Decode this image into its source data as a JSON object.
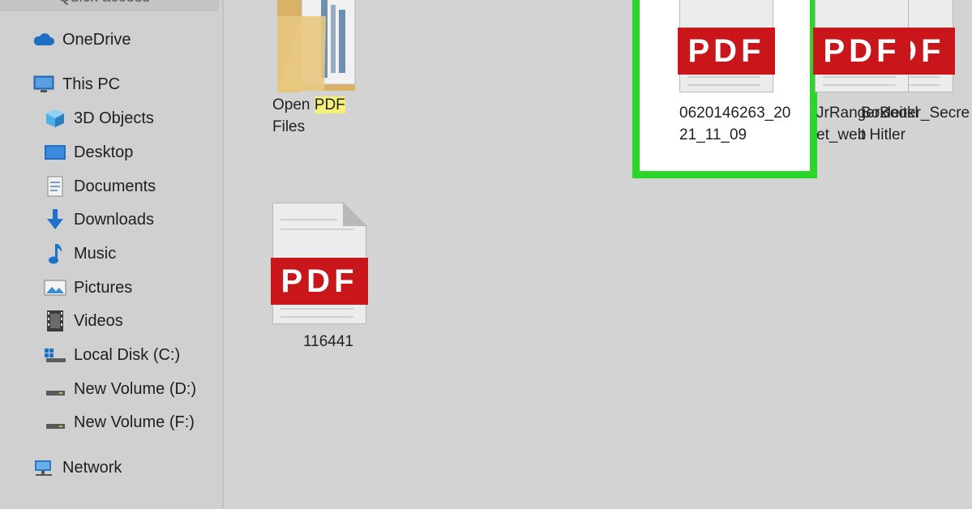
{
  "sidebar": {
    "top_item": "Quick access",
    "items": [
      {
        "label": "OneDrive",
        "icon": "cloud-icon"
      },
      {
        "label": "This PC",
        "icon": "computer-icon"
      },
      {
        "label": "3D Objects",
        "icon": "cube-icon"
      },
      {
        "label": "Desktop",
        "icon": "desktop-icon"
      },
      {
        "label": "Documents",
        "icon": "documents-icon"
      },
      {
        "label": "Downloads",
        "icon": "download-arrow-icon"
      },
      {
        "label": "Music",
        "icon": "music-note-icon"
      },
      {
        "label": "Pictures",
        "icon": "pictures-icon"
      },
      {
        "label": "Videos",
        "icon": "videos-icon"
      },
      {
        "label": "Local Disk (C:)",
        "icon": "windows-drive-icon"
      },
      {
        "label": "New Volume (D:)",
        "icon": "drive-icon"
      },
      {
        "label": "New Volume (F:)",
        "icon": "drive-icon"
      },
      {
        "label": "Network",
        "icon": "network-icon"
      }
    ]
  },
  "files": {
    "folder": {
      "name_before": "Open ",
      "name_highlight": "PDF",
      "name_line2": "Files",
      "icon": "folder-icon"
    },
    "selected": {
      "line1": "0620146263_20",
      "line2": "21_11_09",
      "badge": "PDF"
    },
    "file2": {
      "line1": "Boxleiter_Secre",
      "line2": "t Hitler",
      "badge": "PDF"
    },
    "file3": {
      "line1": "JrRangerBookl",
      "line2": "et_web",
      "badge": "PDF"
    },
    "file4": {
      "line1": "116441",
      "badge": "PDF"
    }
  },
  "colors": {
    "selection_outline": "#2bd62b",
    "pdf_band": "#c8161b",
    "search_highlight": "#f4f07a",
    "background": "#d3d3d3"
  }
}
